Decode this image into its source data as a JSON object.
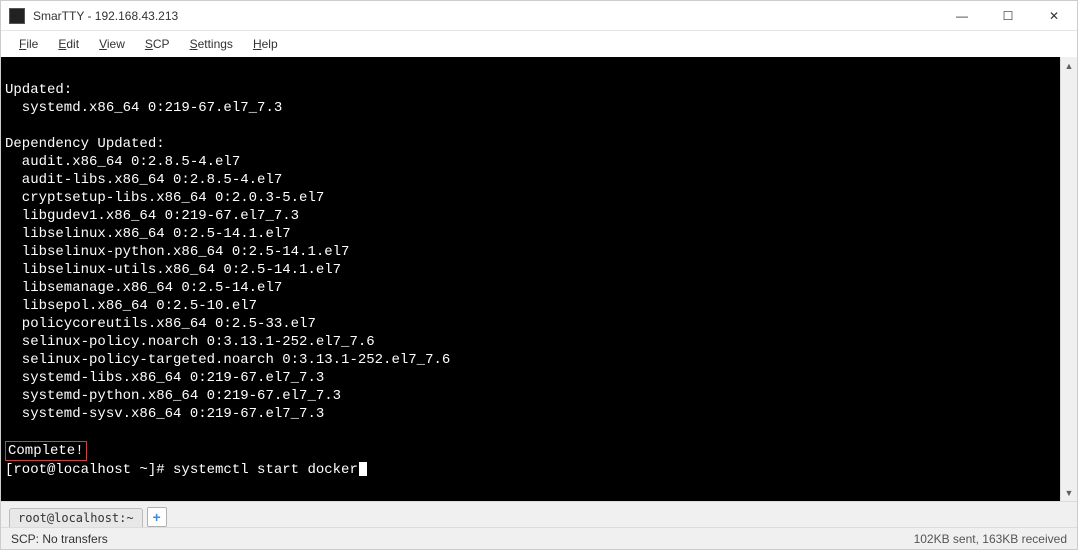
{
  "window": {
    "title": "SmarTTY - 192.168.43.213",
    "minimize": "—",
    "maximize": "☐",
    "close": "✕"
  },
  "menu": {
    "file": "File",
    "edit": "Edit",
    "view": "View",
    "scp": "SCP",
    "settings": "Settings",
    "help": "Help"
  },
  "terminal": {
    "blank0": "",
    "updated_header": "Updated:",
    "updated_line": "  systemd.x86_64 0:219-67.el7_7.3",
    "blank1": "",
    "dep_header": "Dependency Updated:",
    "dep_lines": [
      "  audit.x86_64 0:2.8.5-4.el7",
      "  audit-libs.x86_64 0:2.8.5-4.el7",
      "  cryptsetup-libs.x86_64 0:2.0.3-5.el7",
      "  libgudev1.x86_64 0:219-67.el7_7.3",
      "  libselinux.x86_64 0:2.5-14.1.el7",
      "  libselinux-python.x86_64 0:2.5-14.1.el7",
      "  libselinux-utils.x86_64 0:2.5-14.1.el7",
      "  libsemanage.x86_64 0:2.5-14.el7",
      "  libsepol.x86_64 0:2.5-10.el7",
      "  policycoreutils.x86_64 0:2.5-33.el7",
      "  selinux-policy.noarch 0:3.13.1-252.el7_7.6",
      "  selinux-policy-targeted.noarch 0:3.13.1-252.el7_7.6",
      "  systemd-libs.x86_64 0:219-67.el7_7.3",
      "  systemd-python.x86_64 0:219-67.el7_7.3",
      "  systemd-sysv.x86_64 0:219-67.el7_7.3"
    ],
    "blank2": "",
    "complete": "Complete!",
    "prompt": "[root@localhost ~]# ",
    "command": "systemctl start docker"
  },
  "tabs": {
    "tab0": "root@localhost:~",
    "add": "+"
  },
  "status": {
    "left": "SCP: No transfers",
    "right": "102KB sent, 163KB received"
  }
}
